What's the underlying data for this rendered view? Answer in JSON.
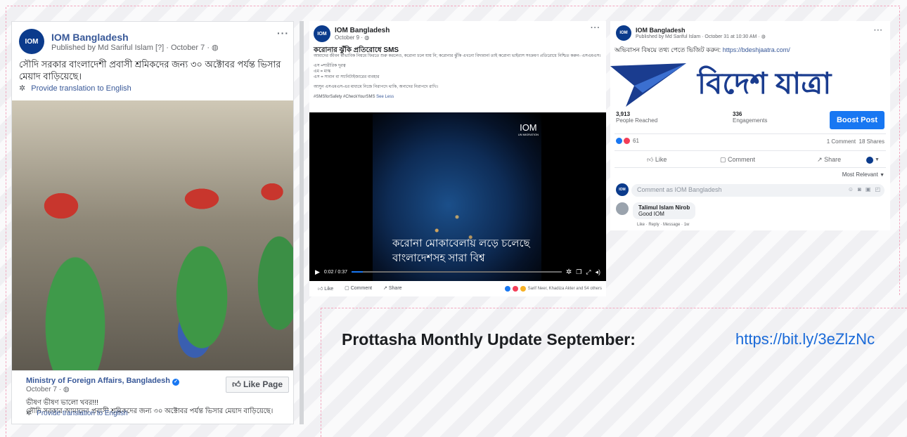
{
  "post1": {
    "page_name": "IOM Bangladesh",
    "meta": "Published by Md Sariful Islam [?] · October 7 ·",
    "text": "সৌদি সরকার বাংলাদেশী প্রবাসী শ্রমিকদের জন্য ৩০ অক্টোবর পর্যন্ত ভিসার মেয়াদ বাড়িয়েছে।",
    "translate": "Provide translation to English",
    "shared": {
      "page_name": "Ministry of Foreign Affairs, Bangladesh",
      "date": "October 7 ·",
      "like_page": "Like Page",
      "line1": "ভীষণ ভীষণ ভালো খবর!!!",
      "line2": "সৌদি সরকার আমাদের প্রবাসী শ্রমিকদের জন্য ৩০ অক্টোবর পর্যন্ত ভিসার মেয়াদ বাড়িয়েছে।",
      "translate": "Provide translation to English"
    }
  },
  "post2": {
    "page_name": "IOM Bangladesh",
    "date": "October 9 ·",
    "headline": "করোনার ঝুঁকি প্রতিরোধে SMS",
    "body1": "আমাদের জীবন স্বাভাবিক নিয়মে ফিরতে শুরু করলেও, করোনা চলে যায় নি; করোনার ঝুঁকি এখনো বিদ্যমান! তাই করোনা ভাইরাস সংক্রমণ প্রতিরোধে নিশ্চিত করুন- এসএমএস।",
    "body2": "এস =শারীরিক দূরত্ব",
    "body3": "এম = মাস্ক",
    "body4": "এস = সাবান বা স্যানিটাইজারের ব্যবহার",
    "body5": "আসুন এসএমএস-এর মাধ্যমে নিজে নিরাপদে থাকি, অন্যদের নিরাপদে রাখি।",
    "hashtags": "#SMSforSafety #CheckYourSMS",
    "see_less": "See Less",
    "video": {
      "brand": "IOM",
      "brand_sub": "UN MIGRATION",
      "caption1": "করোনা মোকাবেলায় লড়ে চলেছে",
      "caption2": "বাংলাদেশসহ সারা বিশ্ব",
      "time": "0:02 / 0:37",
      "progress": 0.054
    },
    "actions": {
      "like": "Like",
      "comment": "Comment",
      "share": "Share"
    },
    "reactions_text": "Sarif Neer, Khadiza Akter and 54 others"
  },
  "post3": {
    "page_name": "IOM Bangladesh",
    "meta": "Published by Md Sariful Islam · October 31 at 10:30 AM ·",
    "text": "অভিবাসন বিষয়ে তথ্য পেতে ভিজিট করুন:",
    "link": "https://bdeshjaatra.com/",
    "banner_text": "বিদেশ যাত্রা",
    "reach": {
      "value": "3,913",
      "label": "People Reached"
    },
    "engagements": {
      "value": "336",
      "label": "Engagements"
    },
    "boost": "Boost Post",
    "reaction_count": "61",
    "comments_shares": "1 Comment  18 Shares",
    "actions": {
      "like": "Like",
      "comment": "Comment",
      "share": "Share"
    },
    "sort": "Most Relevant",
    "comment_placeholder": "Comment as IOM Bangladesh",
    "comment": {
      "author": "Talimul Islam Nirob",
      "text": "Good IOM",
      "meta": "Like · Reply · Message · 1w"
    }
  },
  "footer": {
    "title": "Prottasha Monthly Update September:",
    "link": "https://bit.ly/3eZlzNc"
  },
  "colors": {
    "fb_blue": "#1877f2",
    "iom_blue": "#0b3b8c",
    "banner_blue": "#1a3c8f",
    "dash_pink": "#f2a7bf"
  }
}
